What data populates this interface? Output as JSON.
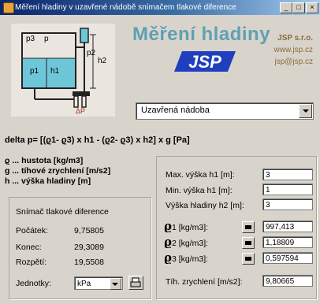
{
  "window": {
    "title": "Měření hladiny v uzavřené nádobě snímačem tlakové diference",
    "buttons": [
      "_",
      "□",
      "×"
    ]
  },
  "diagram": {
    "labels": {
      "p3": "p3",
      "p": "p",
      "p1": "p1",
      "h1": "h1",
      "p2": "p2",
      "h2": "h2",
      "dp": "ΔP"
    }
  },
  "header": {
    "title": "Měření hladiny",
    "company": "JSP s.r.o.",
    "website": "www.jsp.cz",
    "email": "jsp@jsp.cz",
    "logo_text": "JSP"
  },
  "vessel_type": {
    "selected": "Uzavřená nádoba"
  },
  "formula": {
    "text": "delta p= [(ϱ1- ϱ3) x h1 - (ϱ2- ϱ3) x h2] x g  [Pa]"
  },
  "legend": {
    "rho": "ϱ ... hustota [kg/m3]",
    "g": "g   ... tíhové zrychlení [m/s2]",
    "h": "h   ... výška hladiny [m]"
  },
  "sensor": {
    "title": "Snímač tlakové diference",
    "start_label": "Počátek:",
    "start_value": "9,75805",
    "end_label": "Konec:",
    "end_value": "29,3089",
    "span_label": "Rozpětí:",
    "span_value": "19,5508",
    "units_label": "Jednotky:",
    "units_value": "kPa"
  },
  "params": {
    "h1max_label": "Max. výška h1 [m]:",
    "h1max_value": "3",
    "h1min_label": "Min. výška h1 [m]:",
    "h1min_value": "1",
    "h2_label": "Výška hladiny h2 [m]:",
    "h2_value": "3",
    "rho1_label": "1 [kg/m3]:",
    "rho1_value": "997,413",
    "rho2_label": "2 [kg/m3]:",
    "rho2_value": "1,18809",
    "rho3_label": "3 [kg/m3]:",
    "rho3_value": "0,597594",
    "g_label": "Tíh. zrychlení [m/s2]:",
    "g_value": "9,80665",
    "rho_symbol": "ϱ"
  },
  "colors": {
    "accent": "#5fa0b3",
    "brand": "#1f3fbf",
    "company": "#8a6b3d",
    "water": "#6ec7d8"
  }
}
